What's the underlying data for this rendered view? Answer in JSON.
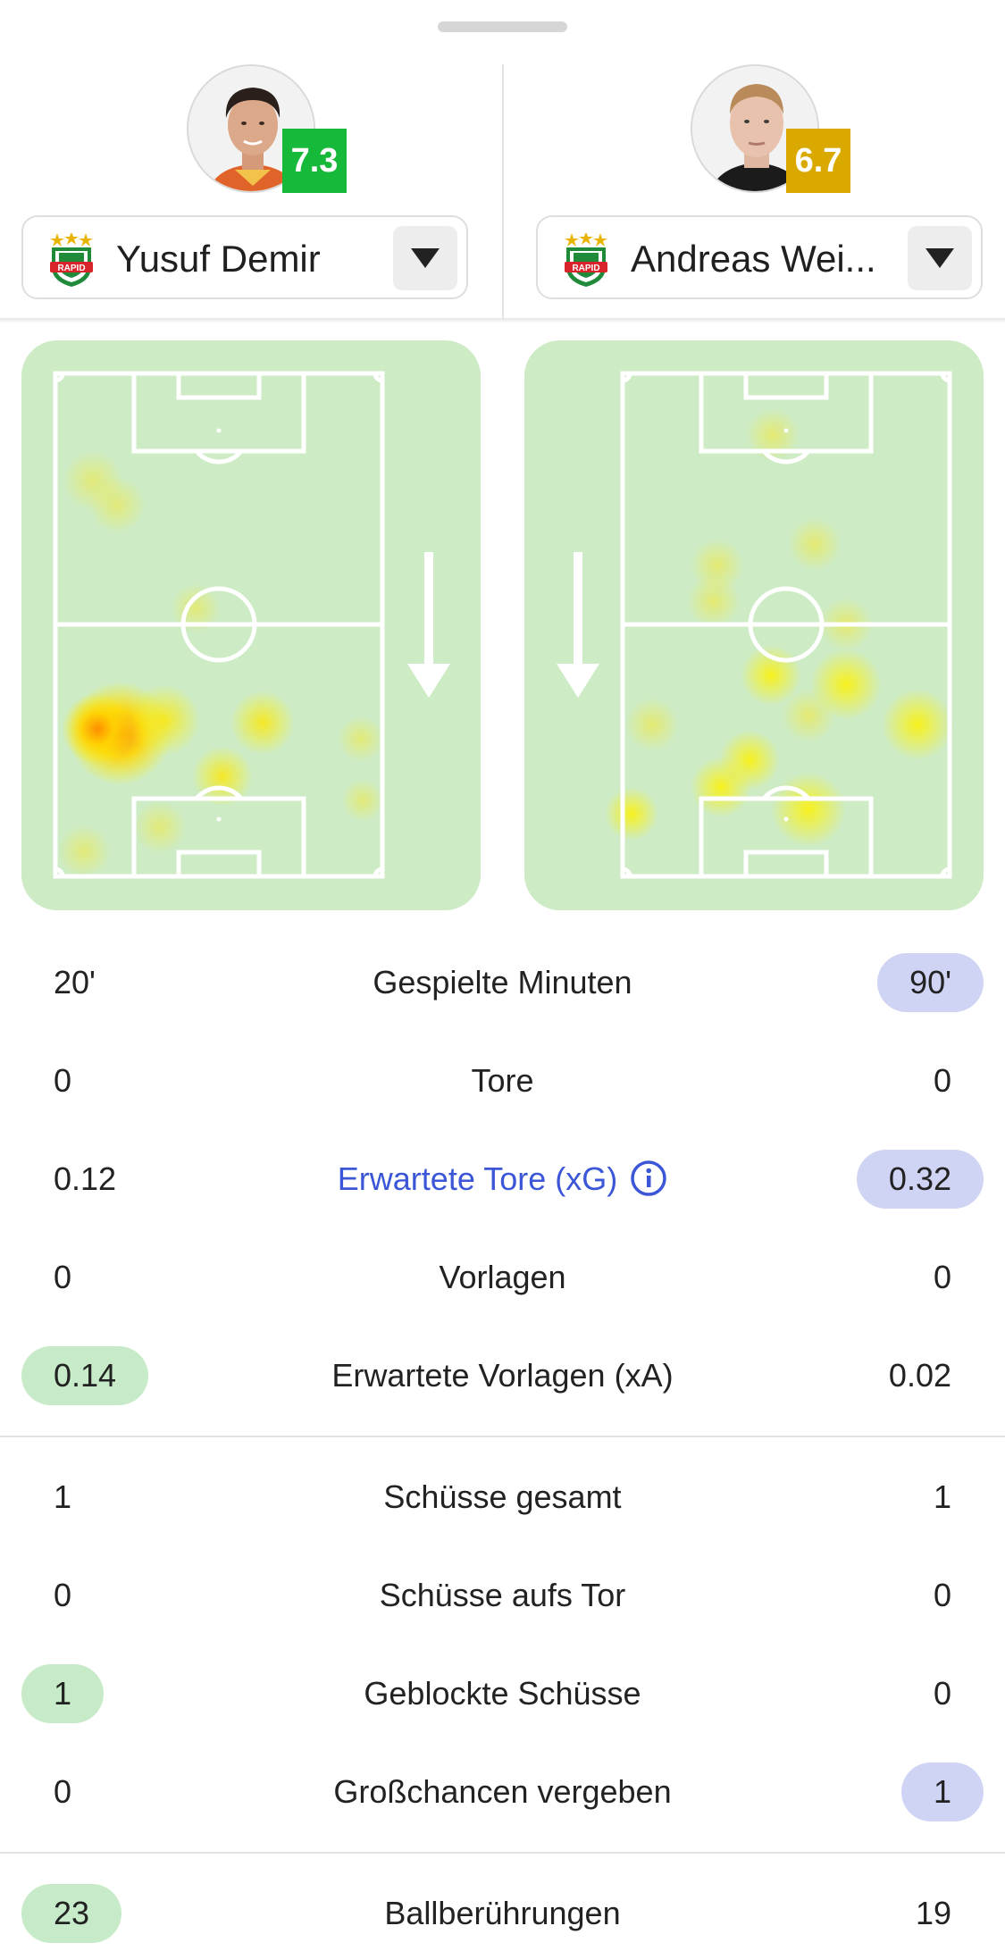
{
  "players": {
    "left": {
      "name": "Yusuf Demir",
      "rating": "7.3",
      "rating_color": "#17b93a",
      "club_logo": "rapid-wien-crest",
      "club_logo_text": "RAPID"
    },
    "right": {
      "name": "Andreas Wei...",
      "rating": "6.7",
      "rating_color": "#d9a900",
      "club_logo": "rapid-wien-crest",
      "club_logo_text": "RAPID"
    }
  },
  "heatmaps": {
    "left": {
      "attack_direction": "down"
    },
    "right": {
      "attack_direction": "down"
    }
  },
  "stats_group1": [
    {
      "label": "Gespielte Minuten",
      "left": "20'",
      "right": "90'",
      "highlight": "right"
    },
    {
      "label": "Tore",
      "left": "0",
      "right": "0",
      "highlight": "none"
    },
    {
      "label": "Erwartete Tore (xG)",
      "left": "0.12",
      "right": "0.32",
      "highlight": "right",
      "link": true
    },
    {
      "label": "Vorlagen",
      "left": "0",
      "right": "0",
      "highlight": "none"
    },
    {
      "label": "Erwartete Vorlagen (xA)",
      "left": "0.14",
      "right": "0.02",
      "highlight": "left"
    }
  ],
  "stats_group2": [
    {
      "label": "Schüsse gesamt",
      "left": "1",
      "right": "1",
      "highlight": "none"
    },
    {
      "label": "Schüsse aufs Tor",
      "left": "0",
      "right": "0",
      "highlight": "none"
    },
    {
      "label": "Geblockte Schüsse",
      "left": "1",
      "right": "0",
      "highlight": "left"
    },
    {
      "label": "Großchancen vergeben",
      "left": "0",
      "right": "1",
      "highlight": "right"
    }
  ],
  "stats_group3": [
    {
      "label": "Ballberührungen",
      "left": "23",
      "right": "19",
      "highlight": "left"
    }
  ],
  "colors": {
    "left_highlight": "#c7ebc8",
    "right_highlight": "#cfd4f4",
    "link": "#3b56d6",
    "pitch": "#cdebc5"
  }
}
